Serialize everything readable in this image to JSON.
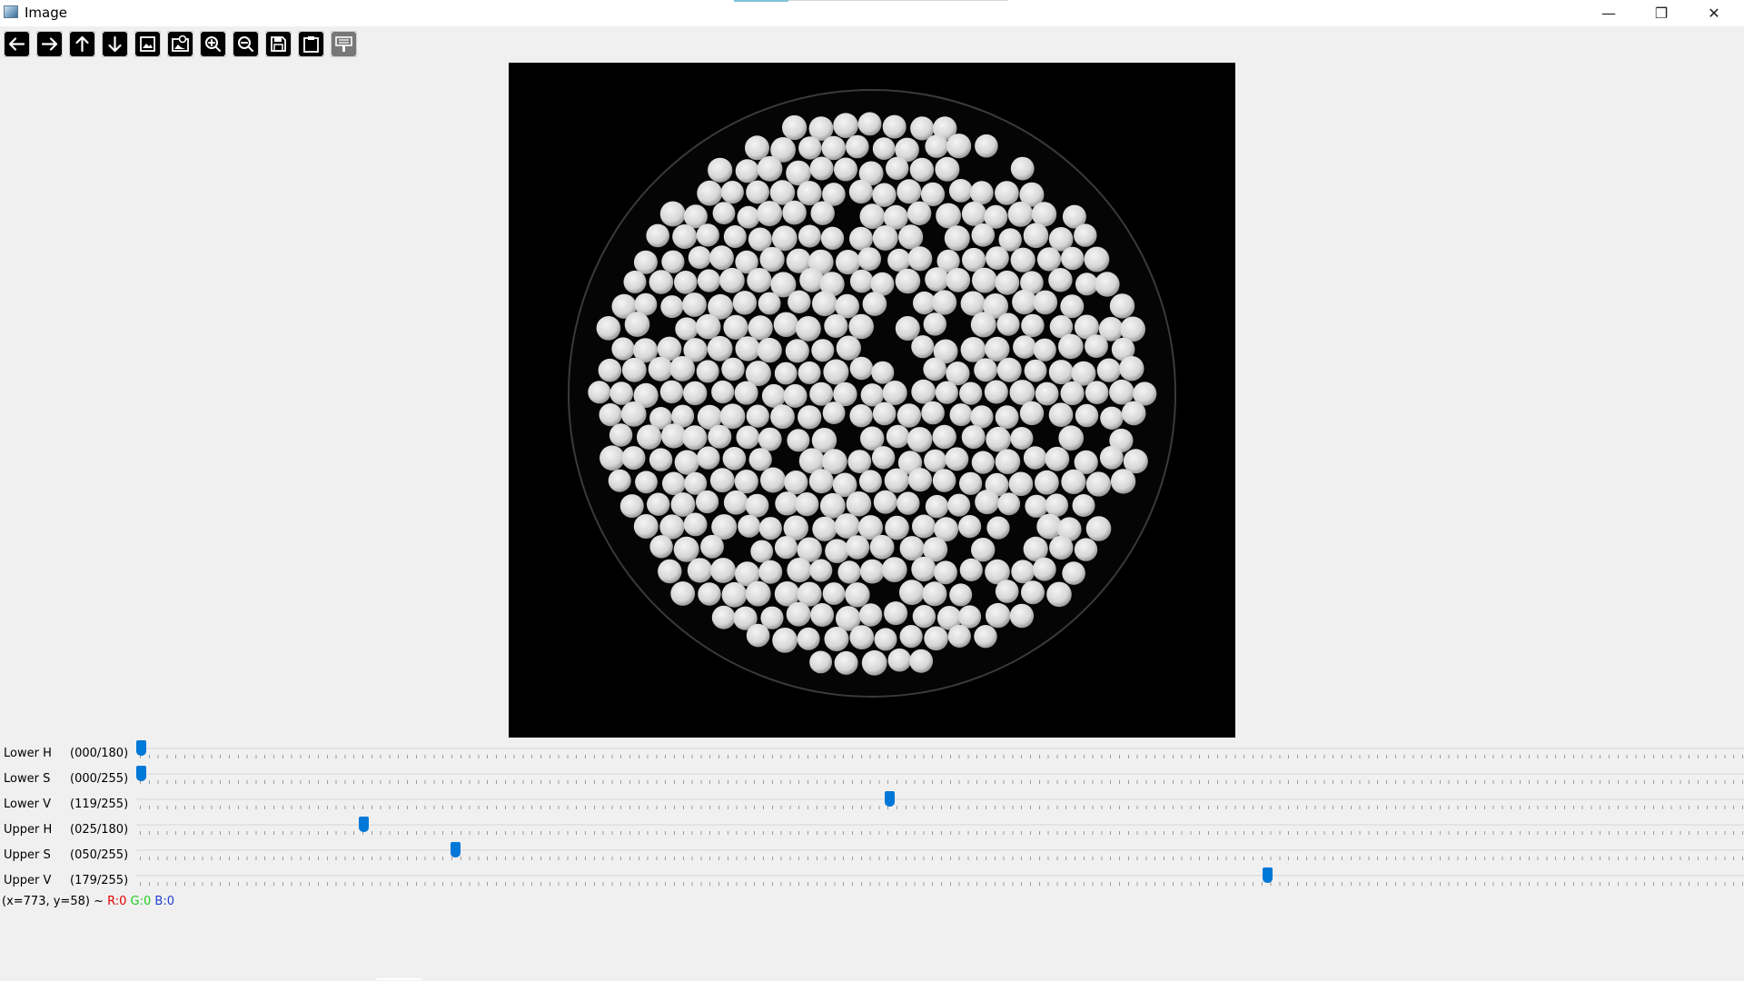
{
  "window": {
    "title": "Image",
    "minimize_glyph": "—",
    "maximize_glyph": "❐",
    "close_glyph": "✕"
  },
  "toolbar": {
    "tools": [
      {
        "name": "pan-left",
        "icon": "arrow-left-icon"
      },
      {
        "name": "pan-right",
        "icon": "arrow-right-icon"
      },
      {
        "name": "pan-up",
        "icon": "arrow-up-icon"
      },
      {
        "name": "pan-down",
        "icon": "arrow-down-icon"
      },
      {
        "name": "zoom-fit",
        "icon": "image-icon"
      },
      {
        "name": "zoom-original",
        "icon": "image-zoom-icon"
      },
      {
        "name": "zoom-in",
        "icon": "zoom-in-icon"
      },
      {
        "name": "zoom-out",
        "icon": "zoom-out-icon"
      },
      {
        "name": "save",
        "icon": "save-icon"
      },
      {
        "name": "copy-clipboard",
        "icon": "clipboard-icon"
      },
      {
        "name": "properties",
        "icon": "properties-icon"
      }
    ]
  },
  "image_viewer": {
    "content": "white spherical beads in a round dish on black background"
  },
  "sliders": [
    {
      "label": "Lower H",
      "value_text": "(000/180)",
      "value": 0,
      "max": 180
    },
    {
      "label": "Lower S",
      "value_text": "(000/255)",
      "value": 0,
      "max": 255
    },
    {
      "label": "Lower V",
      "value_text": "(119/255)",
      "value": 119,
      "max": 255
    },
    {
      "label": "Upper H",
      "value_text": "(025/180)",
      "value": 25,
      "max": 180
    },
    {
      "label": "Upper S",
      "value_text": "(050/255)",
      "value": 50,
      "max": 255
    },
    {
      "label": "Upper V",
      "value_text": "(179/255)",
      "value": 179,
      "max": 255
    }
  ],
  "status": {
    "coords": "(x=773, y=58) ~",
    "r": "R:0",
    "g": "G:0",
    "b": "B:0",
    "colors": {
      "r": "#e00000",
      "g": "#22cc22",
      "b": "#1f3fcf"
    }
  },
  "colors": {
    "accent": "#0078d7",
    "background": "#f0f0f0"
  }
}
